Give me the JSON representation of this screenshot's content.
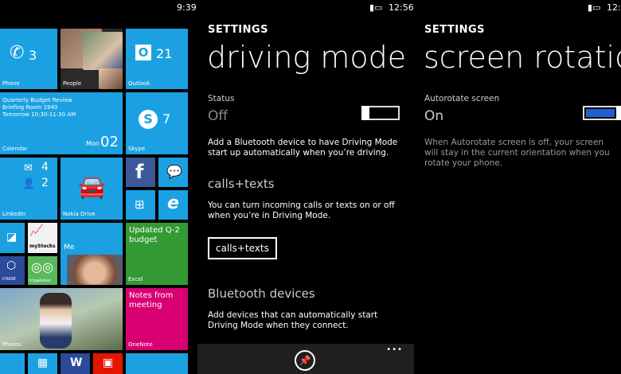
{
  "screen1": {
    "time": "9:39",
    "tiles": {
      "phone": {
        "label": "Phone",
        "count": "3"
      },
      "people": {
        "label": "People"
      },
      "outlook": {
        "label": "Outlook",
        "count": "21"
      },
      "calendar": {
        "label": "Calendar",
        "event": "Quarterly Budget Review",
        "location": "Briefing Room 1940",
        "time": "Tomorrow 10:30-11:30 AM",
        "day": "Mon",
        "date": "02"
      },
      "skype": {
        "label": "Skype",
        "count": "7"
      },
      "linkedin": {
        "label": "LinkedIn",
        "mail_count": "4",
        "invite_count": "2"
      },
      "nokia_drive": {
        "label": "Nokia Drive"
      },
      "me": {
        "label": "Me"
      },
      "excel": {
        "label": "Excel",
        "doc": "Updated Q-2 budget"
      },
      "onenote": {
        "label": "OneNote",
        "doc": "Notes from meeting"
      },
      "photos": {
        "label": "Photos"
      },
      "mystocks": {
        "label": "myStocks"
      },
      "tripadvisor": {
        "label": "tripadvisor"
      },
      "chase": {
        "label": "CHASE"
      }
    }
  },
  "screen2": {
    "time": "12:56",
    "header": "SETTINGS",
    "title": "driving mode",
    "status_label": "Status",
    "status_value": "Off",
    "description": "Add a Bluetooth device to have Driving Mode start up automatically when you’re driving.",
    "calls_heading": "calls+texts",
    "calls_text": "You can turn incoming calls or texts on or off when you’re in Driving Mode.",
    "calls_button": "calls+texts",
    "bt_heading": "Bluetooth devices",
    "bt_text": "Add devices that can automatically start Driving Mode when they connect.",
    "more": "•••"
  },
  "screen3": {
    "time": "12:",
    "header": "SETTINGS",
    "title": "screen rotatio",
    "autorotate_label": "Autorotate screen",
    "autorotate_value": "On",
    "description": "When Autorotate screen is off, your screen will stay in the current orientation when you rotate your phone."
  },
  "colors": {
    "accent": "#1ba1e2",
    "excel": "#339933",
    "onenote": "#d80073",
    "toggle_on": "#1f5fd6"
  }
}
